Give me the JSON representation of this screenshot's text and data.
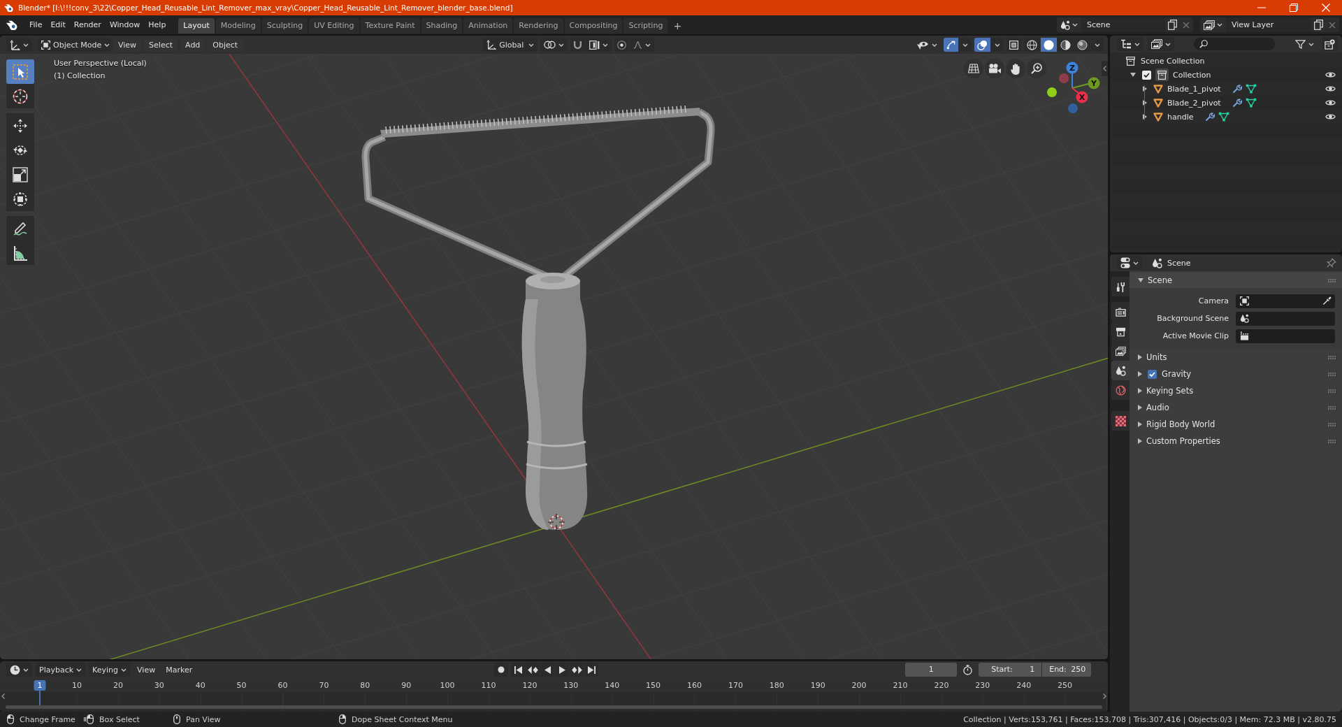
{
  "window": {
    "title": "Blender* [I:\\!!!conv_3\\22\\Copper_Head_Reusable_Lint_Remover_max_vray\\Copper_Head_Reusable_Lint_Remover_blender_base.blend]"
  },
  "menu": [
    "File",
    "Edit",
    "Render",
    "Window",
    "Help"
  ],
  "workspaces": [
    {
      "label": "Layout",
      "selected": true
    },
    {
      "label": "Modeling",
      "selected": false
    },
    {
      "label": "Sculpting",
      "selected": false
    },
    {
      "label": "UV Editing",
      "selected": false
    },
    {
      "label": "Texture Paint",
      "selected": false
    },
    {
      "label": "Shading",
      "selected": false
    },
    {
      "label": "Animation",
      "selected": false
    },
    {
      "label": "Rendering",
      "selected": false
    },
    {
      "label": "Compositing",
      "selected": false
    },
    {
      "label": "Scripting",
      "selected": false
    }
  ],
  "add_workspace": "+",
  "scene": "Scene",
  "view_layer": "View Layer",
  "viewport": {
    "mode": "Object Mode",
    "menus": [
      "View",
      "Select",
      "Add",
      "Object"
    ],
    "orientation": "Global",
    "shading": [
      {
        "selected": false
      },
      {
        "selected": true
      },
      {
        "selected": false
      },
      {
        "selected": false
      }
    ],
    "info": [
      "User Perspective (Local)",
      "(1) Collection"
    ],
    "tools": [
      {
        "selected": true
      },
      {
        "selected": false
      },
      {
        "selected": false
      },
      {
        "selected": false
      },
      {
        "selected": false
      },
      {
        "selected": false
      },
      {
        "selected": false
      },
      {
        "selected": false
      }
    ],
    "axes": {
      "z": "Z",
      "y": "Y",
      "x": "X"
    }
  },
  "outliner": {
    "root": "Scene Collection",
    "collections": [
      {
        "name": "Collection",
        "checked": true,
        "expanded": true,
        "children": [
          {
            "name": "Blade_1_pivot",
            "expanded": false
          },
          {
            "name": "Blade_2_pivot",
            "expanded": false
          },
          {
            "name": "handle",
            "expanded": false
          }
        ]
      }
    ]
  },
  "properties": {
    "context": "Scene",
    "tabs": [
      {
        "selected": false
      },
      {
        "selected": false
      },
      {
        "selected": false
      },
      {
        "selected": false
      },
      {
        "selected": true
      },
      {
        "selected": false
      },
      {
        "selected": false
      }
    ],
    "panels": [
      {
        "title": "Scene",
        "kind": "fields",
        "expanded": true,
        "fields": [
          "Camera",
          "Background Scene",
          "Active Movie Clip"
        ]
      },
      {
        "title": "Units",
        "kind": "plain",
        "expanded": false
      },
      {
        "title": "Gravity",
        "kind": "checkbox",
        "expanded": false,
        "checked": true
      },
      {
        "title": "Keying Sets",
        "kind": "plain",
        "expanded": false
      },
      {
        "title": "Audio",
        "kind": "plain",
        "expanded": false
      },
      {
        "title": "Rigid Body World",
        "kind": "plain",
        "expanded": false
      },
      {
        "title": "Custom Properties",
        "kind": "plain",
        "expanded": false
      }
    ]
  },
  "timeline": {
    "menus": [
      {
        "label": "Playback",
        "dropdown": true
      },
      {
        "label": "Keying",
        "dropdown": true
      },
      {
        "label": "View",
        "dropdown": false
      },
      {
        "label": "Marker",
        "dropdown": false
      }
    ],
    "current_frame": "1",
    "start_label": "Start:",
    "start": "1",
    "end_label": "End:",
    "end": "250",
    "ruler": [
      {
        "label": "1",
        "selected": true
      },
      {
        "label": "10",
        "selected": false
      },
      {
        "label": "20",
        "selected": false
      },
      {
        "label": "30",
        "selected": false
      },
      {
        "label": "40",
        "selected": false
      },
      {
        "label": "50",
        "selected": false
      },
      {
        "label": "60",
        "selected": false
      },
      {
        "label": "70",
        "selected": false
      },
      {
        "label": "80",
        "selected": false
      },
      {
        "label": "90",
        "selected": false
      },
      {
        "label": "100",
        "selected": false
      },
      {
        "label": "110",
        "selected": false
      },
      {
        "label": "120",
        "selected": false
      },
      {
        "label": "130",
        "selected": false
      },
      {
        "label": "140",
        "selected": false
      },
      {
        "label": "150",
        "selected": false
      },
      {
        "label": "160",
        "selected": false
      },
      {
        "label": "170",
        "selected": false
      },
      {
        "label": "180",
        "selected": false
      },
      {
        "label": "190",
        "selected": false
      },
      {
        "label": "200",
        "selected": false
      },
      {
        "label": "210",
        "selected": false
      },
      {
        "label": "220",
        "selected": false
      },
      {
        "label": "230",
        "selected": false
      },
      {
        "label": "240",
        "selected": false
      },
      {
        "label": "250",
        "selected": false
      }
    ]
  },
  "status_bar": {
    "hints": [
      "Change Frame",
      "Box Select",
      "Pan View",
      "Dope Sheet Context Menu"
    ],
    "stats": "Collection | Verts:153,761 | Faces:153,708 | Tris:307,416 | Objects:0/3 | Mem: 72.3 MB | v2.80.75"
  }
}
